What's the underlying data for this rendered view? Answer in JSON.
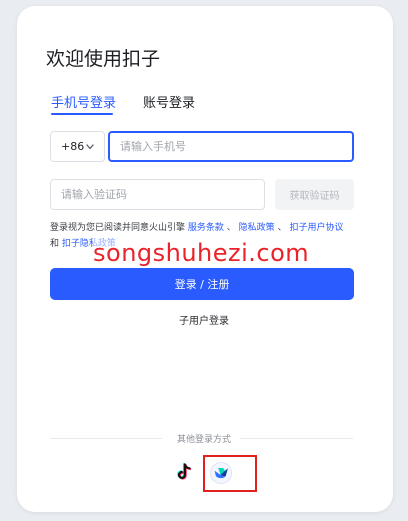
{
  "title": "欢迎使用扣子",
  "tabs": [
    "手机号登录",
    "账号登录"
  ],
  "phone": {
    "country_code": "+86",
    "placeholder": "请输入手机号"
  },
  "code": {
    "placeholder": "请输入验证码",
    "button_label": "获取验证码"
  },
  "agreement": {
    "prefix": "登录视为您已阅读并同意火山引擎",
    "link1": "服务条款",
    "sep1": "、",
    "link2": "隐私政策",
    "sep2": "、",
    "link3": "扣子用户协议",
    "mid": "和",
    "link4": "扣子隐私政策"
  },
  "watermark": "songshuhezi.com",
  "login_button": "登录 / 注册",
  "sub_user_login": "子用户登录",
  "other_methods_label": "其他登录方式",
  "colors": {
    "accent": "#2a5bff",
    "highlight_box": "#e0201e",
    "watermark": "#e8232b"
  },
  "icons": {
    "douyin": "douyin-icon",
    "feishu": "feishu-icon"
  }
}
